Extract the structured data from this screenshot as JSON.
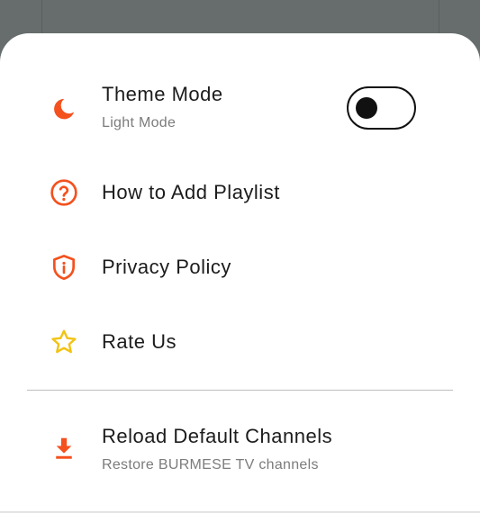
{
  "settings_sheet": {
    "theme_mode": {
      "title": "Theme Mode",
      "subtitle": "Light Mode",
      "icon": "moon-icon",
      "toggle_on": false
    },
    "how_to_add_playlist": {
      "title": "How to Add Playlist",
      "icon": "help-circle-icon"
    },
    "privacy_policy": {
      "title": "Privacy Policy",
      "icon": "shield-info-icon"
    },
    "rate_us": {
      "title": "Rate Us",
      "icon": "star-outline-icon"
    },
    "reload_default_channels": {
      "title": "Reload Default Channels",
      "subtitle": "Restore BURMESE TV channels",
      "icon": "download-icon"
    }
  },
  "colors": {
    "accent": "#f4511e",
    "star": "#f2c313",
    "toggle": "#111111",
    "backdrop": "#666d6c"
  }
}
